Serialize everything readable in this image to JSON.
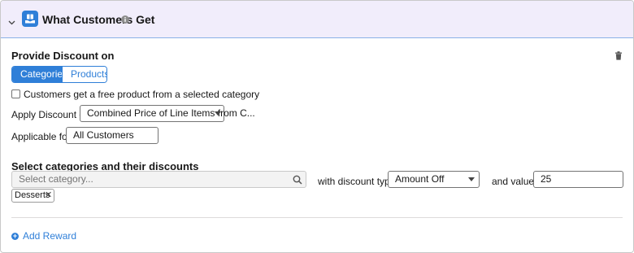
{
  "header": {
    "title": "What Customers Get",
    "icons": {
      "collapse": "chevron-down-icon",
      "app": "gift-box-icon",
      "info": "info-icon"
    }
  },
  "discount": {
    "title": "Provide Discount on",
    "tabs": [
      "Categories",
      "Products"
    ],
    "active_tab": "Categories",
    "checkbox_label": "Customers get a free product from a selected category",
    "checkbox_checked": false,
    "apply_label": "Apply Discount on",
    "apply_value": "Combined Price of Line Items from C...",
    "applicable_label": "Applicable for",
    "applicable_value": "All Customers"
  },
  "categories": {
    "title": "Select categories and their discounts",
    "search_placeholder": "Select category...",
    "selected": [
      "Desserts"
    ],
    "discount_type_label": "with discount type",
    "discount_type_value": "Amount Off",
    "value_label": "and value",
    "value": "25"
  },
  "footer": {
    "add_reward_label": "Add Reward"
  },
  "colors": {
    "accent": "#2f7fd8",
    "header_bg": "#f1edfb"
  }
}
